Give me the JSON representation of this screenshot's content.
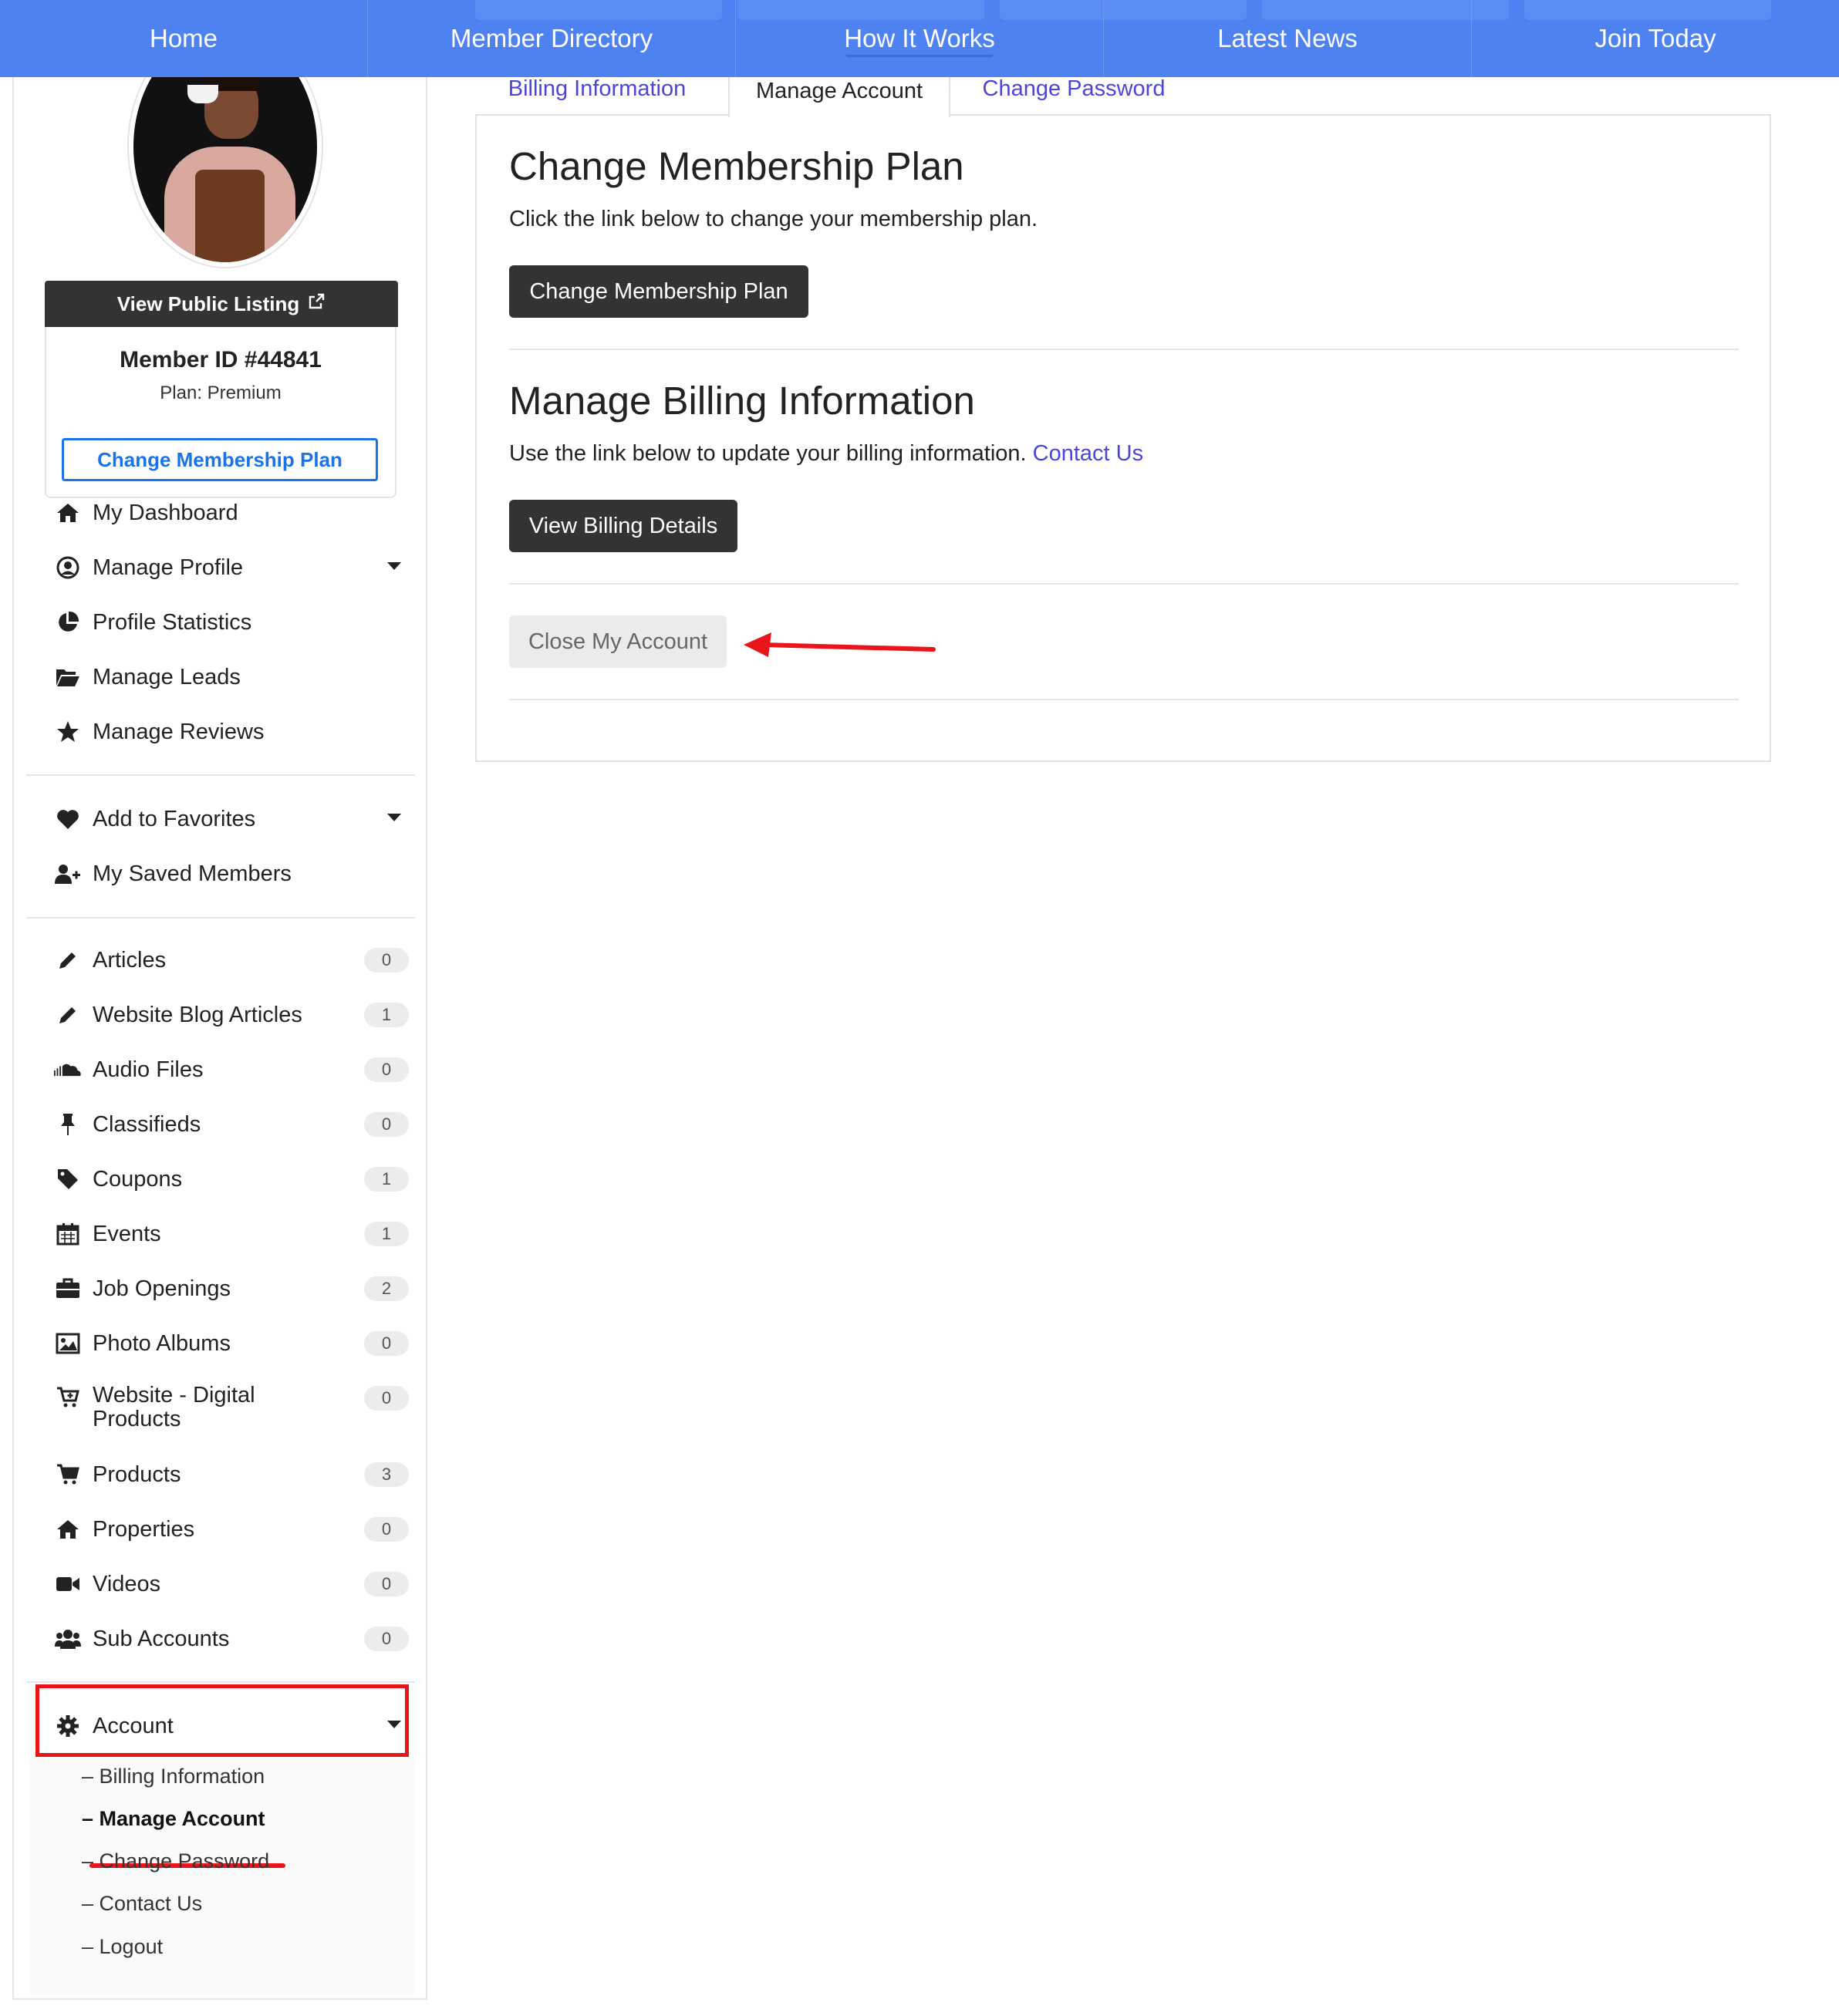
{
  "topnav": {
    "items": [
      "Home",
      "Member Directory",
      "How It Works",
      "Latest News",
      "Join Today"
    ]
  },
  "sidebar": {
    "view_public_listing": "View Public Listing",
    "member_id": "Member ID #44841",
    "plan": "Plan: Premium",
    "change_plan": "Change Membership Plan",
    "menu": [
      {
        "label": "My Dashboard",
        "icon": "home-icon"
      },
      {
        "label": "Manage Profile",
        "icon": "user-circle-icon",
        "dropdown": true
      },
      {
        "label": "Profile Statistics",
        "icon": "pie-chart-icon"
      },
      {
        "label": "Manage Leads",
        "icon": "folder-open-icon"
      },
      {
        "label": "Manage Reviews",
        "icon": "star-icon"
      }
    ],
    "menu2": [
      {
        "label": "Add to Favorites",
        "icon": "heart-icon",
        "dropdown": true
      },
      {
        "label": "My Saved Members",
        "icon": "user-plus-icon"
      }
    ],
    "content": [
      {
        "label": "Articles",
        "icon": "pencil-icon",
        "count": "0"
      },
      {
        "label": "Website Blog Articles",
        "icon": "pencil-icon",
        "count": "1"
      },
      {
        "label": "Audio Files",
        "icon": "soundcloud-icon",
        "count": "0"
      },
      {
        "label": "Classifieds",
        "icon": "thumbtack-icon",
        "count": "0"
      },
      {
        "label": "Coupons",
        "icon": "tag-icon",
        "count": "1"
      },
      {
        "label": "Events",
        "icon": "calendar-icon",
        "count": "1"
      },
      {
        "label": "Job Openings",
        "icon": "briefcase-icon",
        "count": "2"
      },
      {
        "label": "Photo Albums",
        "icon": "image-icon",
        "count": "0"
      },
      {
        "label": "Website - Digital",
        "label2": "Products",
        "icon": "cart-plus-icon",
        "count": "0"
      },
      {
        "label": "Products",
        "icon": "cart-icon",
        "count": "3"
      },
      {
        "label": "Properties",
        "icon": "home-icon",
        "count": "0"
      },
      {
        "label": "Videos",
        "icon": "video-icon",
        "count": "0"
      },
      {
        "label": "Sub Accounts",
        "icon": "users-icon",
        "count": "0"
      }
    ],
    "account": {
      "label": "Account",
      "icon": "gear-icon"
    },
    "account_sub": [
      "– Billing Information",
      "– Manage Account",
      "– Change Password",
      "– Contact Us",
      "– Logout"
    ]
  },
  "tabs": [
    "Billing Information",
    "Manage Account",
    "Change Password"
  ],
  "main": {
    "plan_heading": "Change Membership Plan",
    "plan_text": "Click the link below to change your membership plan.",
    "plan_button": "Change Membership Plan",
    "billing_heading": "Manage Billing Information",
    "billing_text": "Use the link below to update your billing information.",
    "billing_link": "Contact Us",
    "billing_button": "View Billing Details",
    "close_button": "Close My Account"
  },
  "colors": {
    "nav": "#4d82f0",
    "link": "#4b46d9",
    "outline_button": "#1a73e8",
    "annotation_red": "#e8161b"
  }
}
